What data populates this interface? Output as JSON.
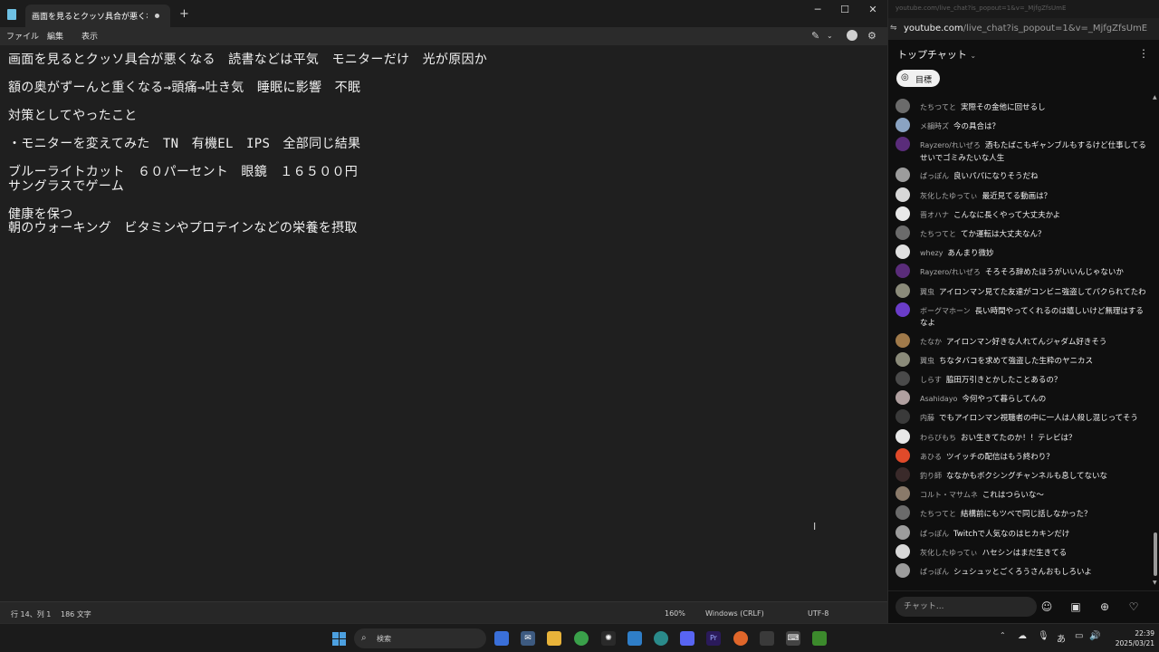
{
  "notepad": {
    "tab_title": "画面を見るとクッソ具合が悪くなる　読書",
    "new_tab": "+",
    "window_controls": {
      "minimize": "─",
      "maximize": "☐",
      "close": "✕"
    },
    "menu": [
      "ファイル",
      "編集",
      "表示"
    ],
    "lines": [
      "画面を見るとクッソ具合が悪くなる　読書などは平気　モニターだけ　光が原因か",
      "",
      "額の奥がずーんと重くなる→頭痛→吐き気　睡眠に影響　不眠",
      "",
      "対策としてやったこと",
      "",
      "・モニターを変えてみた　TN　有機EL　IPS　全部同じ結果",
      "",
      "ブルーライトカット　６０パーセント　眼鏡　１６５００円",
      "サングラスでゲーム",
      "",
      "健康を保つ",
      "朝のウォーキング　ビタミンやプロテインなどの栄養を摂取"
    ],
    "status": {
      "position": "行 14、列 1",
      "chars": "186 文字",
      "zoom": "160%",
      "line_ending": "Windows (CRLF)",
      "encoding": "UTF-8"
    }
  },
  "chat_window": {
    "top_url": "youtube.com/live_chat?is_popout=1&v=_MjfgZfsUmE",
    "url_host": "youtube.com",
    "url_path": "/live_chat?is_popout=1&v=_MjfgZfsUmE",
    "title": "トップチャット",
    "goal_label": "目標",
    "input_placeholder": "チャット...",
    "messages": [
      {
        "author": "たちつてと",
        "text": "実際その金他に回せるし",
        "color": "#6b6b6b"
      },
      {
        "author": "メ韻時ズ",
        "text": "今の具合は？",
        "color": "#8aa3c2"
      },
      {
        "author": "Rayzero/れいぜろ",
        "text": "酒もたばこもギャンブルもするけど仕事してるせいでゴミみたいな人生",
        "color": "#5a2c7a"
      },
      {
        "author": "ぱっぽん",
        "text": "良いパパになりそうだね",
        "color": "#9c9c9c"
      },
      {
        "author": "灰化したゆってぃ",
        "text": "最近見てる動画は？",
        "color": "#d8d8d8"
      },
      {
        "author": "晋オハナ",
        "text": "こんなに長くやって大丈夫かよ",
        "color": "#e8e8e8"
      },
      {
        "author": "たちつてと",
        "text": "てか運転は大丈夫なん？",
        "color": "#6b6b6b"
      },
      {
        "author": "whezy",
        "text": "あんまり微妙",
        "color": "#e0e0e0"
      },
      {
        "author": "Rayzero/れいぜろ",
        "text": "そろそろ辞めたほうがいいんじゃないか",
        "color": "#5a2c7a"
      },
      {
        "author": "翼虫",
        "text": "アイロンマン見てた友達がコンビニ強盗してパクられてたわ",
        "color": "#8b8b7a"
      },
      {
        "author": "ボーグマホーン",
        "text": "長い時間やってくれるのは嬉しいけど無理はするなよ",
        "color": "#6a3cc8"
      },
      {
        "author": "たなか",
        "text": "アイロンマン好きな人れてんジャダム好きそう",
        "color": "#a07a4a"
      },
      {
        "author": "翼虫",
        "text": "ちなタバコを求めて強盗した生粋のヤニカス",
        "color": "#8b8b7a"
      },
      {
        "author": "しらす",
        "text": "脇田万引きとかしたことあるの？",
        "color": "#4a4a4a"
      },
      {
        "author": "Asahidayo",
        "text": "今何やって暮らしてんの",
        "color": "#b0a0a0"
      },
      {
        "author": "内藤",
        "text": "でもアイロンマン視聴者の中に一人は人殺し混じってそう",
        "color": "#3a3a3a"
      },
      {
        "author": "わらびもち",
        "text": "おい生きてたのか！！テレビは？",
        "color": "#e8e8e8"
      },
      {
        "author": "あひる",
        "text": "ツイッチの配信はもう終わり？",
        "color": "#e04a2a"
      },
      {
        "author": "釣り師",
        "text": "ななかもボクシングチャンネルも息してないな",
        "color": "#3a2a2a"
      },
      {
        "author": "コルト・マサムネ",
        "text": "これはつらいな〜",
        "color": "#8a7a6a"
      },
      {
        "author": "たちつてと",
        "text": "結構前にもツベで同じ話しなかった？",
        "color": "#6b6b6b"
      },
      {
        "author": "ぱっぽん",
        "text": "Twitchで人気なのはヒカキンだけ",
        "color": "#9c9c9c"
      },
      {
        "author": "灰化したゆってぃ",
        "text": "ハセシンはまだ生きてる",
        "color": "#d8d8d8"
      },
      {
        "author": "ぱっぽん",
        "text": "シュシュッとごくろうさんおもしろいよ",
        "color": "#9c9c9c"
      }
    ]
  },
  "taskbar": {
    "search_label": "検索",
    "clock_time": "22:39",
    "clock_date": "2025/03/21",
    "ime": "あ"
  }
}
